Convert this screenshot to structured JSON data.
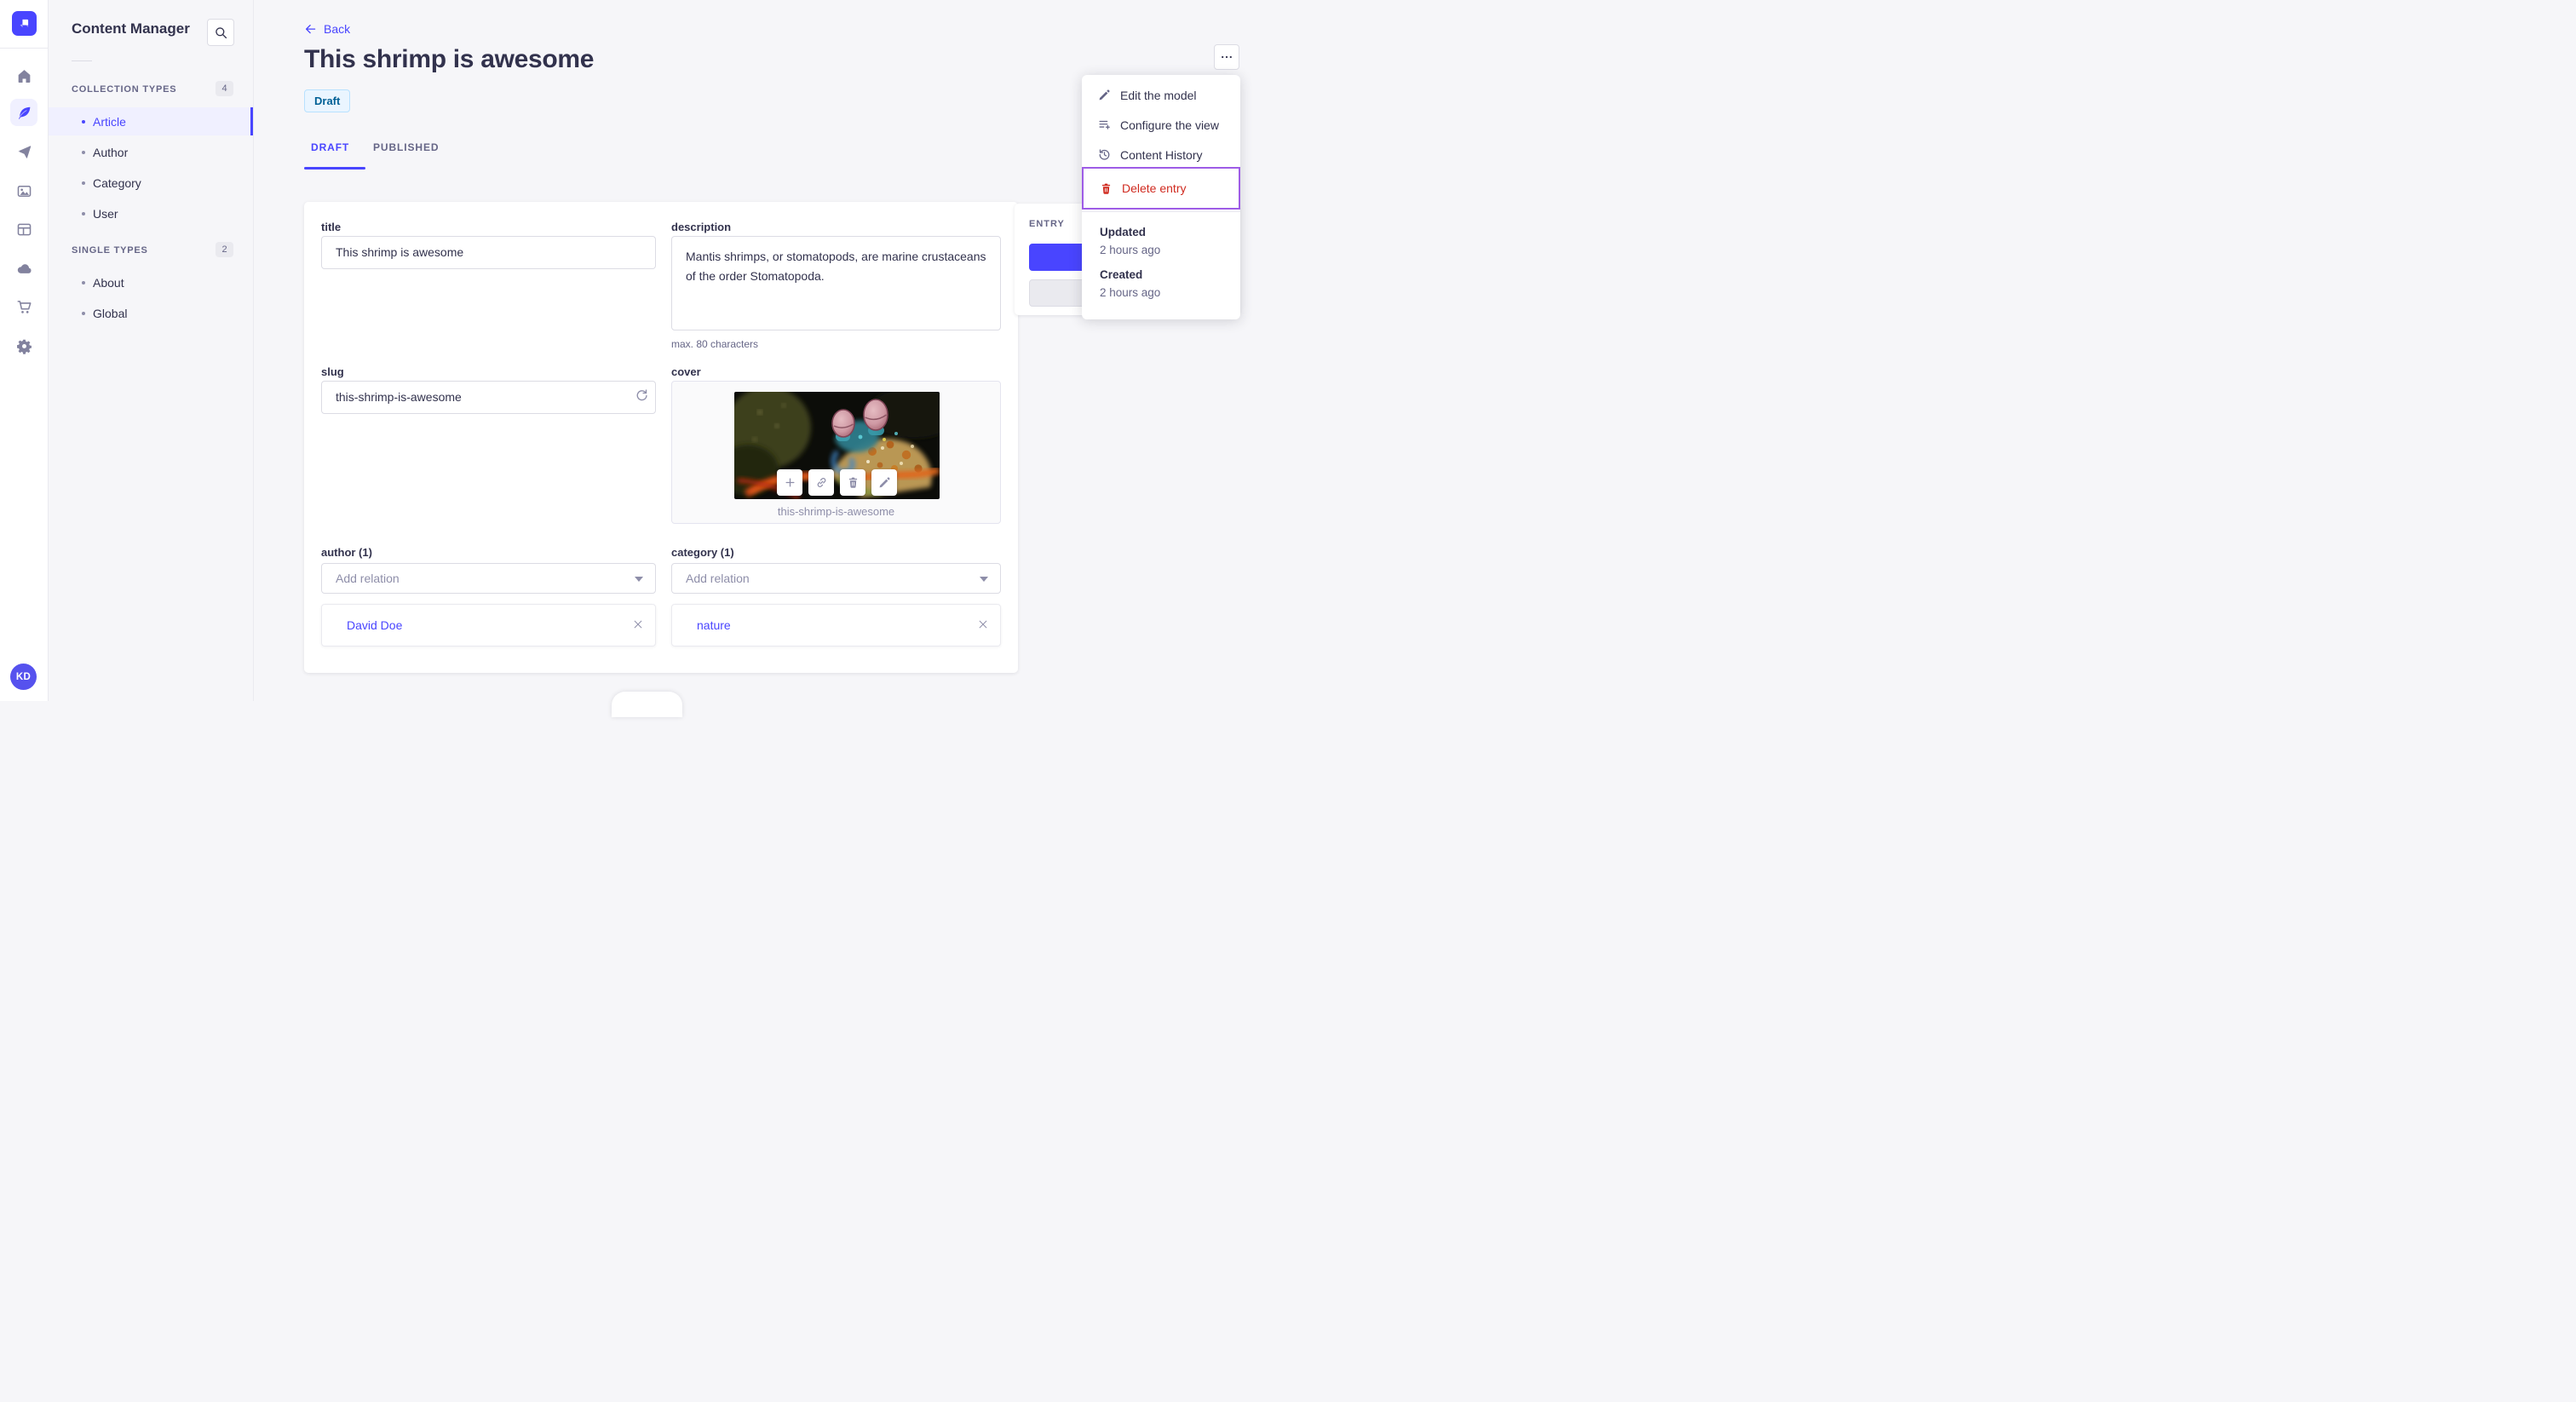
{
  "colors": {
    "primary": "#4945ff",
    "primary_light_bg": "#f0f0ff",
    "danger": "#d02b20",
    "focus_highlight": "#9e5ce6",
    "draft_badge_bg": "#eaf5ff",
    "draft_badge_border": "#b8e1ff",
    "draft_badge_text": "#006096",
    "background": "#f6f6f9"
  },
  "icons": {
    "rail": [
      "home-icon",
      "feather-icon",
      "send-icon",
      "media-icon",
      "layout-icon",
      "cloud-icon",
      "cart-icon",
      "gear-icon"
    ],
    "menu": [
      "pencil-icon",
      "configure-icon",
      "history-icon",
      "trash-icon"
    ],
    "cover_actions": [
      "plus-icon",
      "link-icon",
      "trash-icon",
      "pencil-icon"
    ],
    "misc": [
      "search-icon",
      "back-arrow-icon",
      "more-dots-icon",
      "refresh-icon",
      "close-icon",
      "caret-down-icon"
    ]
  },
  "rail": {
    "avatar_initials": "KD"
  },
  "sidebar": {
    "title": "Content Manager",
    "sections": [
      {
        "label": "COLLECTION TYPES",
        "count": "4",
        "items": [
          {
            "label": "Article"
          },
          {
            "label": "Author"
          },
          {
            "label": "Category"
          },
          {
            "label": "User"
          }
        ]
      },
      {
        "label": "SINGLE TYPES",
        "count": "2",
        "items": [
          {
            "label": "About"
          },
          {
            "label": "Global"
          }
        ]
      }
    ]
  },
  "header": {
    "back_label": "Back",
    "title": "This shrimp is awesome",
    "status_badge": "Draft",
    "tabs": [
      {
        "label": "DRAFT"
      },
      {
        "label": "PUBLISHED"
      }
    ]
  },
  "form": {
    "title_field": {
      "label": "title",
      "value": "This shrimp is awesome"
    },
    "description_field": {
      "label": "description",
      "value": "Mantis shrimps, or stomatopods, are marine crustaceans of the order Stomatopoda.",
      "hint": "max. 80 characters"
    },
    "slug_field": {
      "label": "slug",
      "value": "this-shrimp-is-awesome"
    },
    "cover_field": {
      "label": "cover",
      "caption": "this-shrimp-is-awesome"
    },
    "author_field": {
      "label": "author (1)",
      "placeholder": "Add relation",
      "relation": "David Doe"
    },
    "category_field": {
      "label": "category (1)",
      "placeholder": "Add relation",
      "relation": "nature"
    }
  },
  "entry_panel": {
    "title": "ENTRY"
  },
  "actions_menu": {
    "items": [
      {
        "label": "Edit the model"
      },
      {
        "label": "Configure the view"
      },
      {
        "label": "Content History"
      },
      {
        "label": "Delete entry"
      }
    ],
    "footer": {
      "updated_label": "Updated",
      "updated_value": "2 hours ago",
      "created_label": "Created",
      "created_value": "2 hours ago"
    }
  }
}
